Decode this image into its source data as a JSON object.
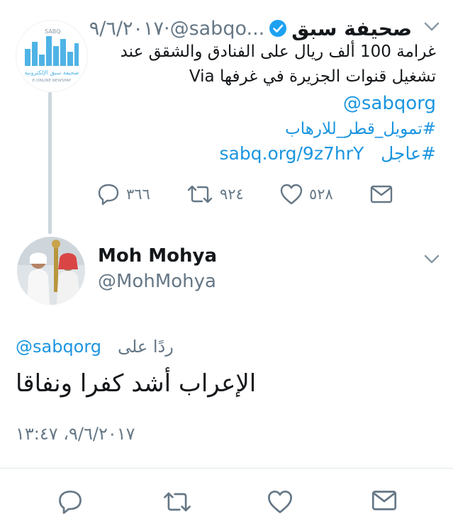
{
  "parent_tweet": {
    "logo": {
      "icon": "sabq-logo",
      "small_text": "SABQ",
      "arabic_caption": "صحيفة سبق الإلكترونية",
      "english_caption": "E-ONLINE NEWSPAP"
    },
    "display_name": "صحيفة سبق",
    "verified_icon": "verified-badge-icon",
    "handle": "@sabqo...",
    "date": "٩/٦/٢٠١٧",
    "date_separator": " · ",
    "text_line1": "غرامة 100 ألف ريال على الفنادق والشقق عند",
    "text_line2": "تشغيل قنوات الجزيرة في غرفها Via",
    "mention": "@sabqorg",
    "hashtag1": "#تمويل_قطر_للارهاب",
    "hashtag2": "#عاجل",
    "url": "sabq.org/9z7hrY",
    "counts": {
      "replies": "٣٦٦",
      "retweets": "٩٢٤",
      "likes": "٥٢٨"
    }
  },
  "reply_tweet": {
    "display_name": "Moh Mohya",
    "handle": "@MohMohya",
    "replying_label": "ردًا على",
    "replying_handle": "@sabqorg",
    "text": "الإعراب أشد كفرا ونفاقا",
    "timestamp": "٩/٦/٢٠١٧، ١٣:٤٧"
  },
  "icons": {
    "reply": "reply-icon",
    "retweet": "retweet-icon",
    "like": "heart-icon",
    "message": "envelope-icon",
    "more": "chevron-down-icon"
  },
  "colors": {
    "link": "#1b95e0",
    "secondary_text": "#657786",
    "primary_text": "#14171a",
    "thread_line": "#ccd6dd"
  }
}
